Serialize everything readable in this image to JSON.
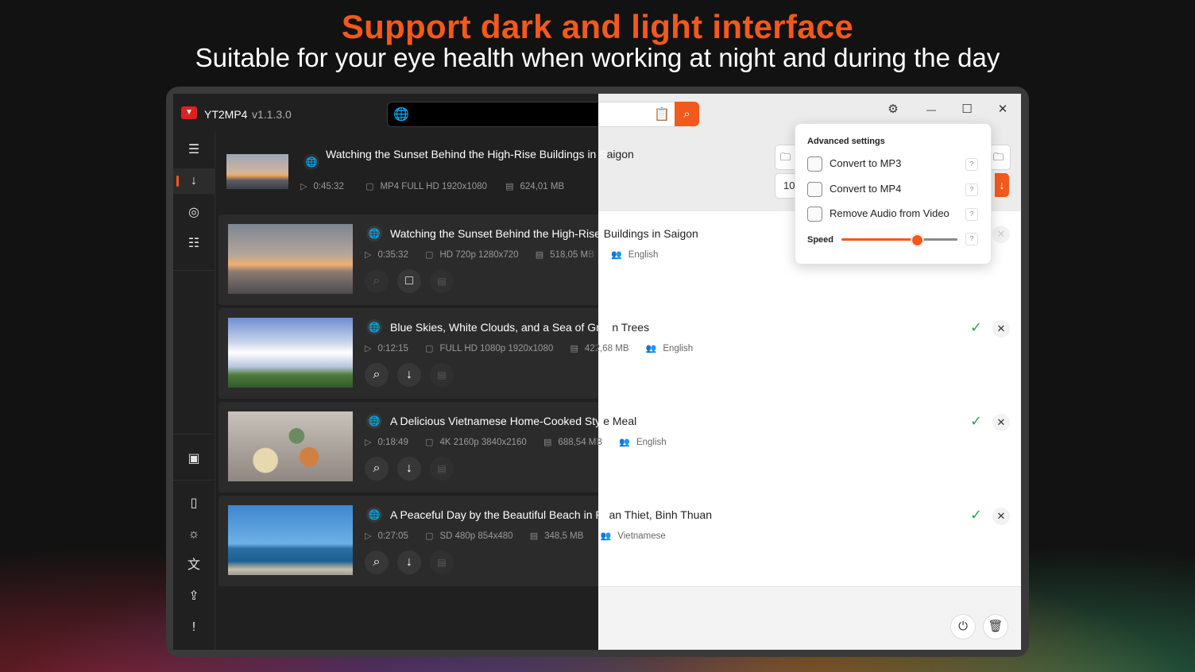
{
  "promo": {
    "title": "Support dark and light interface",
    "subtitle": "Suitable for your eye health when working at night and during the day"
  },
  "app": {
    "name": "YT2MP4",
    "version": "v1.1.3.0",
    "accent_color": "#f2591c"
  },
  "header_video": {
    "title_dark": "Watching the Sunset Behind the High-Rise Buildings in S",
    "title_light": "aigon",
    "duration": "0:45:32",
    "format": "MP4 FULL HD 1920x1080",
    "size": "624,01 MB",
    "quality_field_value": "10"
  },
  "videos": [
    {
      "title_dark": "Watching the Sunset Behind the High-Rise",
      "title_light": " Buildings in Saigon",
      "duration": "0:35:32",
      "resolution": "HD 720p 1280x720",
      "size_dark": "518,05 M",
      "size_light": "B",
      "language": "English",
      "status": "downloading"
    },
    {
      "title_dark": "Blue Skies, White Clouds, and a Sea of Gree",
      "title_light": "n Trees",
      "duration": "0:12:15",
      "resolution": "FULL HD 1080p 1920x1080",
      "size_dark": "42",
      "size_light": "2,68 MB",
      "language": "English",
      "status": "done"
    },
    {
      "title_dark": "A Delicious Vietnamese Home-Cooked Styl",
      "title_light": "e Meal",
      "duration": "0:18:49",
      "resolution": "4K 2160p 3840x2160",
      "size_dark": "688,54 M",
      "size_light": "B",
      "language": "English",
      "status": "done"
    },
    {
      "title_dark": "A Peaceful Day by the Beautiful Beach in Ph",
      "title_light": "an Thiet, Binh Thuan",
      "duration": "0:27:05",
      "resolution": "SD 480p 854x480",
      "size_dark": "348,5 MB",
      "size_light": "",
      "language": "Vietnamese",
      "status": "done"
    }
  ],
  "settings_popup": {
    "title": "Advanced settings",
    "options": [
      {
        "label": "Convert to MP3",
        "checked": false
      },
      {
        "label": "Convert to MP4",
        "checked": false
      },
      {
        "label": "Remove Audio from Video",
        "checked": false
      }
    ],
    "help_mark": "?",
    "speed_label": "Speed",
    "speed_value": 0.65
  },
  "icons": {
    "globe": "🌐",
    "search": "⌕",
    "paste": "📋",
    "settings": "⚙",
    "minimize": "—",
    "maximize": "☐",
    "close": "✕",
    "menu": "☰",
    "download": "↓",
    "stop": "□",
    "folder": "📁",
    "check": "✓",
    "power": "⏻",
    "trash": "🗑"
  }
}
